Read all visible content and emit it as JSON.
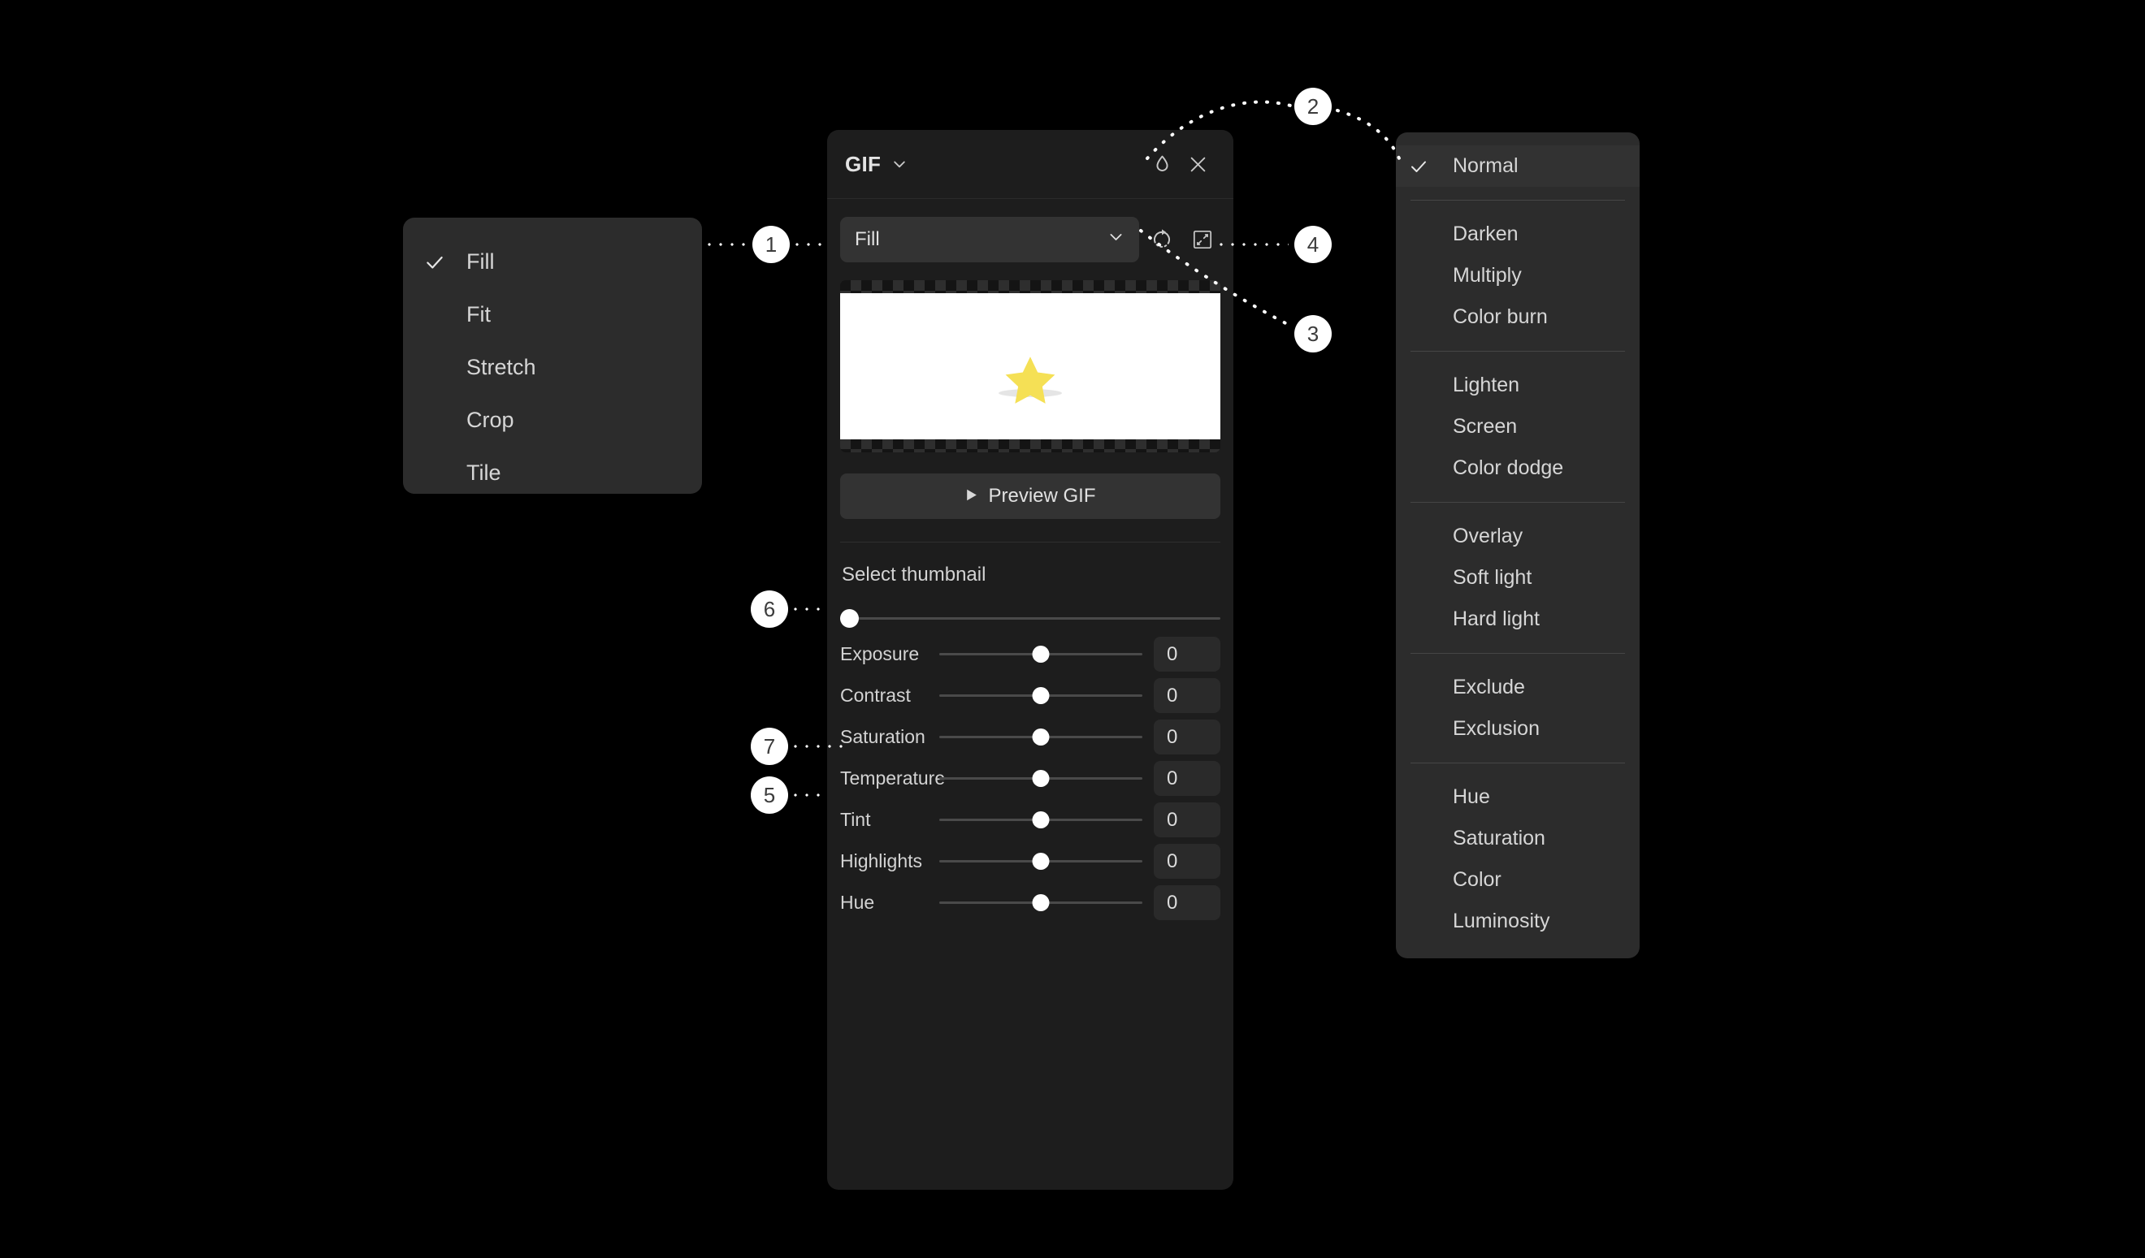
{
  "fit_menu": {
    "name": "fit-mode-menu",
    "items": [
      {
        "label": "Fill",
        "checked": true
      },
      {
        "label": "Fit",
        "checked": false
      },
      {
        "label": "Stretch",
        "checked": false
      },
      {
        "label": "Crop",
        "checked": false
      },
      {
        "label": "Tile",
        "checked": false
      }
    ]
  },
  "blend_menu": {
    "name": "blend-mode-menu",
    "groups": [
      {
        "items": [
          {
            "label": "Normal",
            "checked": true
          }
        ]
      },
      {
        "items": [
          {
            "label": "Darken",
            "checked": false
          },
          {
            "label": "Multiply",
            "checked": false
          },
          {
            "label": "Color burn",
            "checked": false
          }
        ]
      },
      {
        "items": [
          {
            "label": "Lighten",
            "checked": false
          },
          {
            "label": "Screen",
            "checked": false
          },
          {
            "label": "Color dodge",
            "checked": false
          }
        ]
      },
      {
        "items": [
          {
            "label": "Overlay",
            "checked": false
          },
          {
            "label": "Soft light",
            "checked": false
          },
          {
            "label": "Hard light",
            "checked": false
          }
        ]
      },
      {
        "items": [
          {
            "label": "Exclude",
            "checked": false
          },
          {
            "label": "Exclusion",
            "checked": false
          }
        ]
      },
      {
        "items": [
          {
            "label": "Hue",
            "checked": false
          },
          {
            "label": "Saturation",
            "checked": false
          },
          {
            "label": "Color",
            "checked": false
          },
          {
            "label": "Luminosity",
            "checked": false
          }
        ]
      }
    ]
  },
  "panel": {
    "title": "GIF",
    "title_chevron_icon": "chevron-down-icon",
    "blend_icon": "droplet-icon",
    "close_icon": "close-icon",
    "fit_select_value": "Fill",
    "fit_select_chevron_icon": "chevron-down-icon",
    "rotate_icon": "rotate-icon",
    "expand_icon": "expand-icon",
    "preview_button_label": "Preview GIF",
    "preview_button_icon": "play-icon",
    "thumbnail_label": "Select thumbnail",
    "thumbnail_value": 0,
    "image_accent_color": "#f5e055",
    "image_background_color": "#ffffff",
    "adjustments": [
      {
        "label": "Exposure",
        "value": "0"
      },
      {
        "label": "Contrast",
        "value": "0"
      },
      {
        "label": "Saturation",
        "value": "0"
      },
      {
        "label": "Temperature",
        "value": "0"
      },
      {
        "label": "Tint",
        "value": "0"
      },
      {
        "label": "Highlights",
        "value": "0"
      },
      {
        "label": "Hue",
        "value": "0"
      }
    ]
  },
  "callouts": [
    {
      "id": "1",
      "target": "fit-select"
    },
    {
      "id": "2",
      "target": "blend-mode-button"
    },
    {
      "id": "3",
      "target": "image-preview"
    },
    {
      "id": "4",
      "target": "expand-button"
    },
    {
      "id": "5",
      "target": "exposure-row"
    },
    {
      "id": "6",
      "target": "preview-gif-button"
    },
    {
      "id": "7",
      "target": "thumbnail-slider"
    }
  ]
}
